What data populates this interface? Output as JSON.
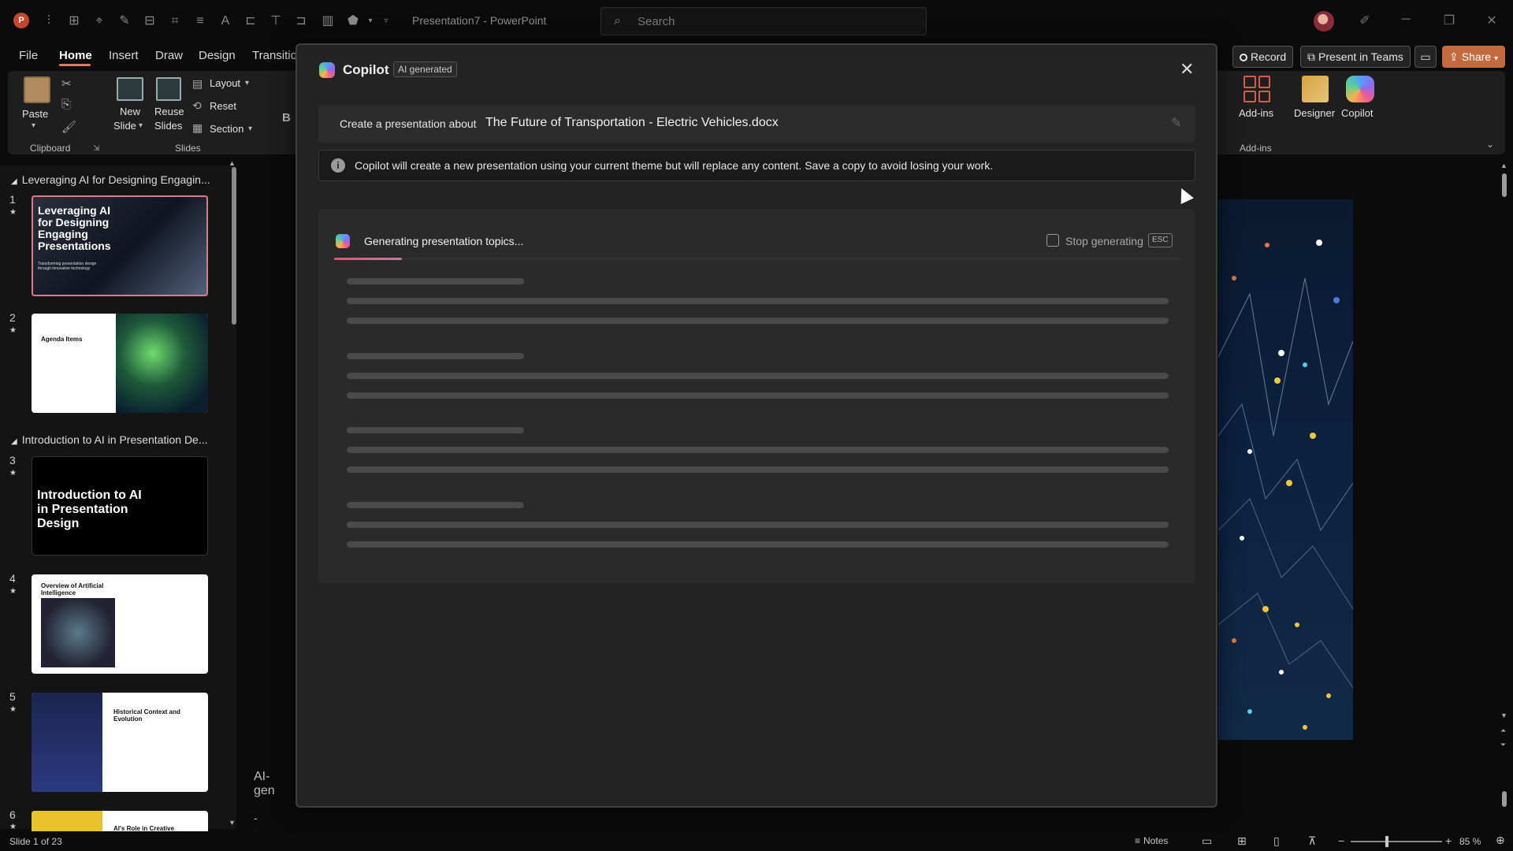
{
  "titlebar": {
    "title": "Presentation7 - PowerPoint",
    "search_placeholder": "Search"
  },
  "tabs": [
    {
      "label": "File"
    },
    {
      "label": "Home"
    },
    {
      "label": "Insert"
    },
    {
      "label": "Draw"
    },
    {
      "label": "Design"
    },
    {
      "label": "Transitio"
    }
  ],
  "ribbon": {
    "paste": "Paste",
    "clipboard": "Clipboard",
    "new_slide_1": "New",
    "new_slide_2": "Slide",
    "reuse_1": "Reuse",
    "reuse_2": "Slides",
    "layout": "Layout",
    "reset": "Reset",
    "section": "Section",
    "slides": "Slides",
    "bold": "B",
    "addins": "Add-ins",
    "addins_group": "Add-ins",
    "designer": "Designer",
    "copilot": "Copilot"
  },
  "top_buttons": {
    "record": "Record",
    "present_in_teams": "Present in Teams",
    "share": "Share"
  },
  "sections": [
    {
      "label": "Leveraging AI for Designing Engagin..."
    },
    {
      "label": "Introduction to AI in Presentation De..."
    }
  ],
  "slides": [
    {
      "num": "1",
      "title": "Leveraging AI for Designing Engaging Presentations",
      "subtitle": "Transforming presentation design through innovative technology"
    },
    {
      "num": "2",
      "title": "Agenda Items"
    },
    {
      "num": "3",
      "title": "Introduction to AI in Presentation Design"
    },
    {
      "num": "4",
      "title": "Overview of Artificial Intelligence"
    },
    {
      "num": "5",
      "title": "Historical Context and Evolution"
    },
    {
      "num": "6",
      "title": "AI's Role in Creative"
    }
  ],
  "dialog": {
    "title": "Copilot",
    "badge": "AI generated",
    "prompt_label": "Create a presentation about",
    "prompt_value": "The Future of Transportation - Electric Vehicles.docx",
    "info": "Copilot will create a new presentation using your current theme but will replace any content. Save a copy to avoid losing your work.",
    "generating": "Generating presentation topics...",
    "stop": "Stop generating",
    "esc": "ESC",
    "progress": 0.08
  },
  "notes_area": {
    "line1": "AI-gen",
    "line2": "---"
  },
  "status": {
    "slide_count": "Slide 1 of 23",
    "notes": "Notes",
    "zoom": "85 %"
  },
  "colors": {
    "accent": "#e07a5f",
    "share_bg": "#c46a3f"
  }
}
